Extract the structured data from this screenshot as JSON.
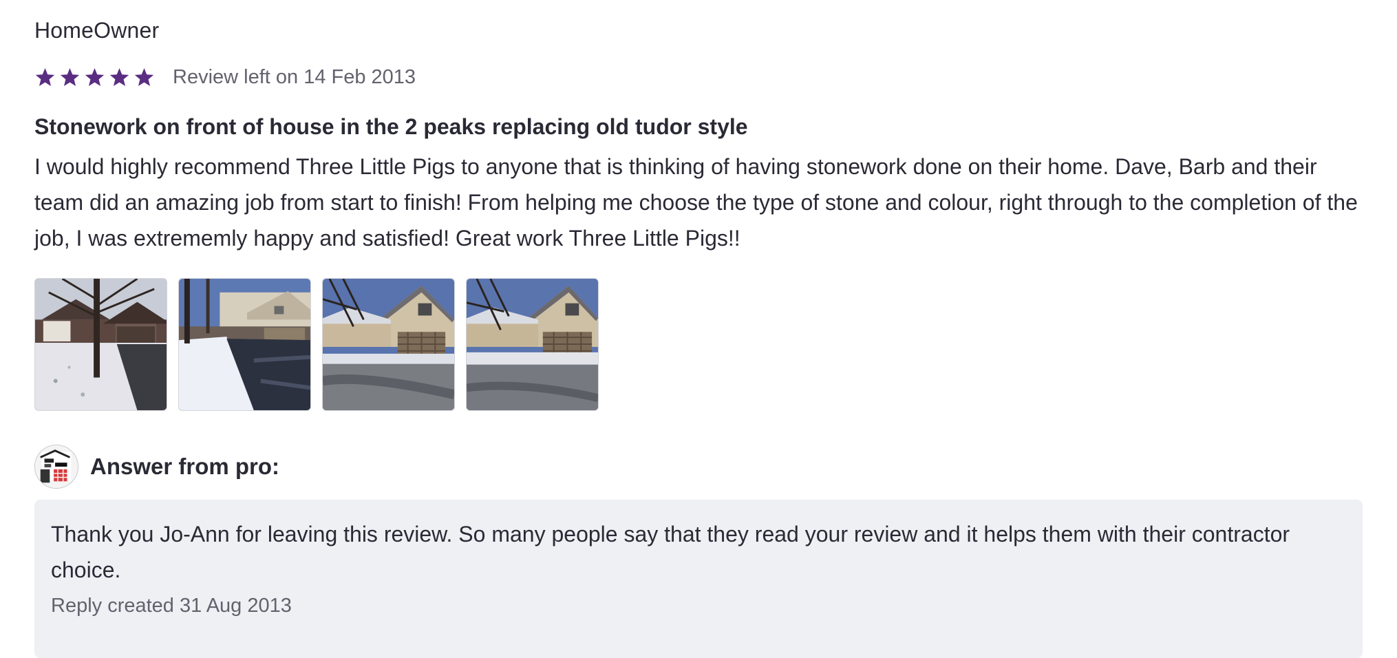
{
  "review": {
    "author": "HomeOwner",
    "rating": 5,
    "rating_max": 5,
    "star_color": "#5a2d82",
    "date_label": "Review left on 14 Feb 2013",
    "title": "Stonework on front of house in the 2 peaks replacing old tudor style",
    "body": "I would highly recommend Three Little Pigs to anyone that is thinking of having stonework done on their home. Dave, Barb and their team did an amazing job from start to finish! From helping me choose the type of stone and colour, right through to the completion of the job, I was extrememly happy and satisfied! Great work Three Little Pigs!!",
    "photos": [
      {
        "icon": "house-photo-tree-foreground"
      },
      {
        "icon": "house-photo-snowy-driveway"
      },
      {
        "icon": "house-photo-front-gable"
      },
      {
        "icon": "house-photo-front-gable-2"
      }
    ]
  },
  "pro_answer": {
    "label": "Answer from pro:",
    "avatar_icon": "three-little-pigs-logo",
    "reply": "Thank you Jo-Ann for leaving this review. So many people say that they read your review and it helps them with their contractor choice.",
    "reply_date_label": "Reply created 31 Aug 2013",
    "box_color": "#eef0f4"
  }
}
